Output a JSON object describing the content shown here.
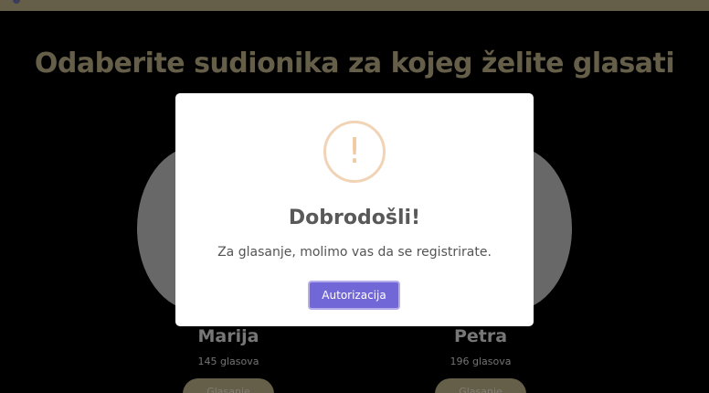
{
  "page": {
    "title": "Odaberite sudionika za kojeg želite glasati"
  },
  "candidates": [
    {
      "name": "Marija",
      "votes": "145 glasova",
      "button_label": "Glasanje"
    },
    {
      "name": "Petra",
      "votes": "196 glasova",
      "button_label": "Glasanje"
    }
  ],
  "modal": {
    "icon": "exclamation-icon",
    "icon_glyph": "!",
    "title": "Dobrodošli!",
    "text": "Za glasanje, molimo vas da se registrirate.",
    "button_label": "Autorizacija"
  },
  "colors": {
    "accent_gold": "#b8ab86",
    "modal_button": "#7267d6",
    "warning_icon": "#f1d3b6",
    "background": "#000000"
  }
}
